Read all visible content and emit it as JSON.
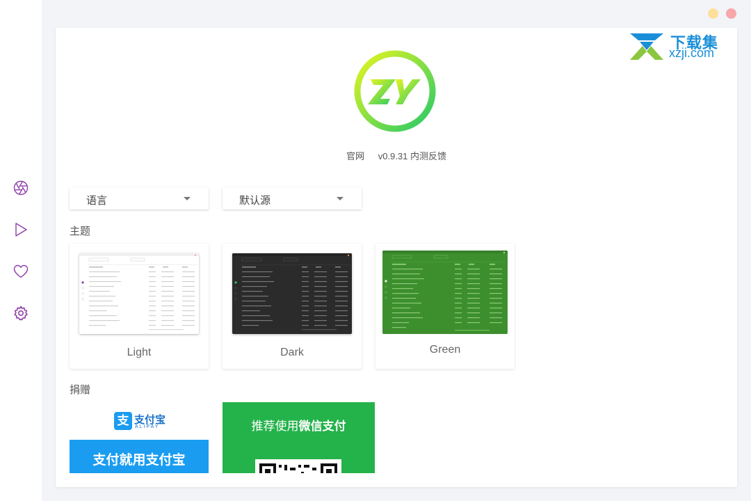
{
  "sidebar": {
    "items": [
      {
        "name": "aperture-icon",
        "label": "discover"
      },
      {
        "name": "play-icon",
        "label": "play"
      },
      {
        "name": "heart-icon",
        "label": "favorites"
      },
      {
        "name": "gear-icon",
        "label": "settings"
      }
    ],
    "accent": "#8e3fa8"
  },
  "watermark": {
    "line1": "下载集",
    "line2": "xzji.com"
  },
  "about": {
    "website_link": "官网",
    "version_text": "v0.9.31 内测反馈"
  },
  "settings": {
    "language_select": "语言",
    "source_select": "默认源"
  },
  "theme": {
    "section_title": "主题",
    "options": [
      {
        "label": "Light"
      },
      {
        "label": "Dark"
      },
      {
        "label": "Green"
      }
    ]
  },
  "donate": {
    "section_title": "捐赠",
    "alipay": {
      "brand": "支付宝",
      "brand_en": "ALIPAY",
      "slogan": "支付就用支付宝"
    },
    "wechat": {
      "text_prefix": "推荐使用",
      "text_bold": "微信支付"
    }
  },
  "colors": {
    "alipay_blue": "#1a9cf0",
    "wechat_green": "#24b24a",
    "green_theme": "#3d8f2e",
    "dark_theme": "#2b2b2b"
  }
}
